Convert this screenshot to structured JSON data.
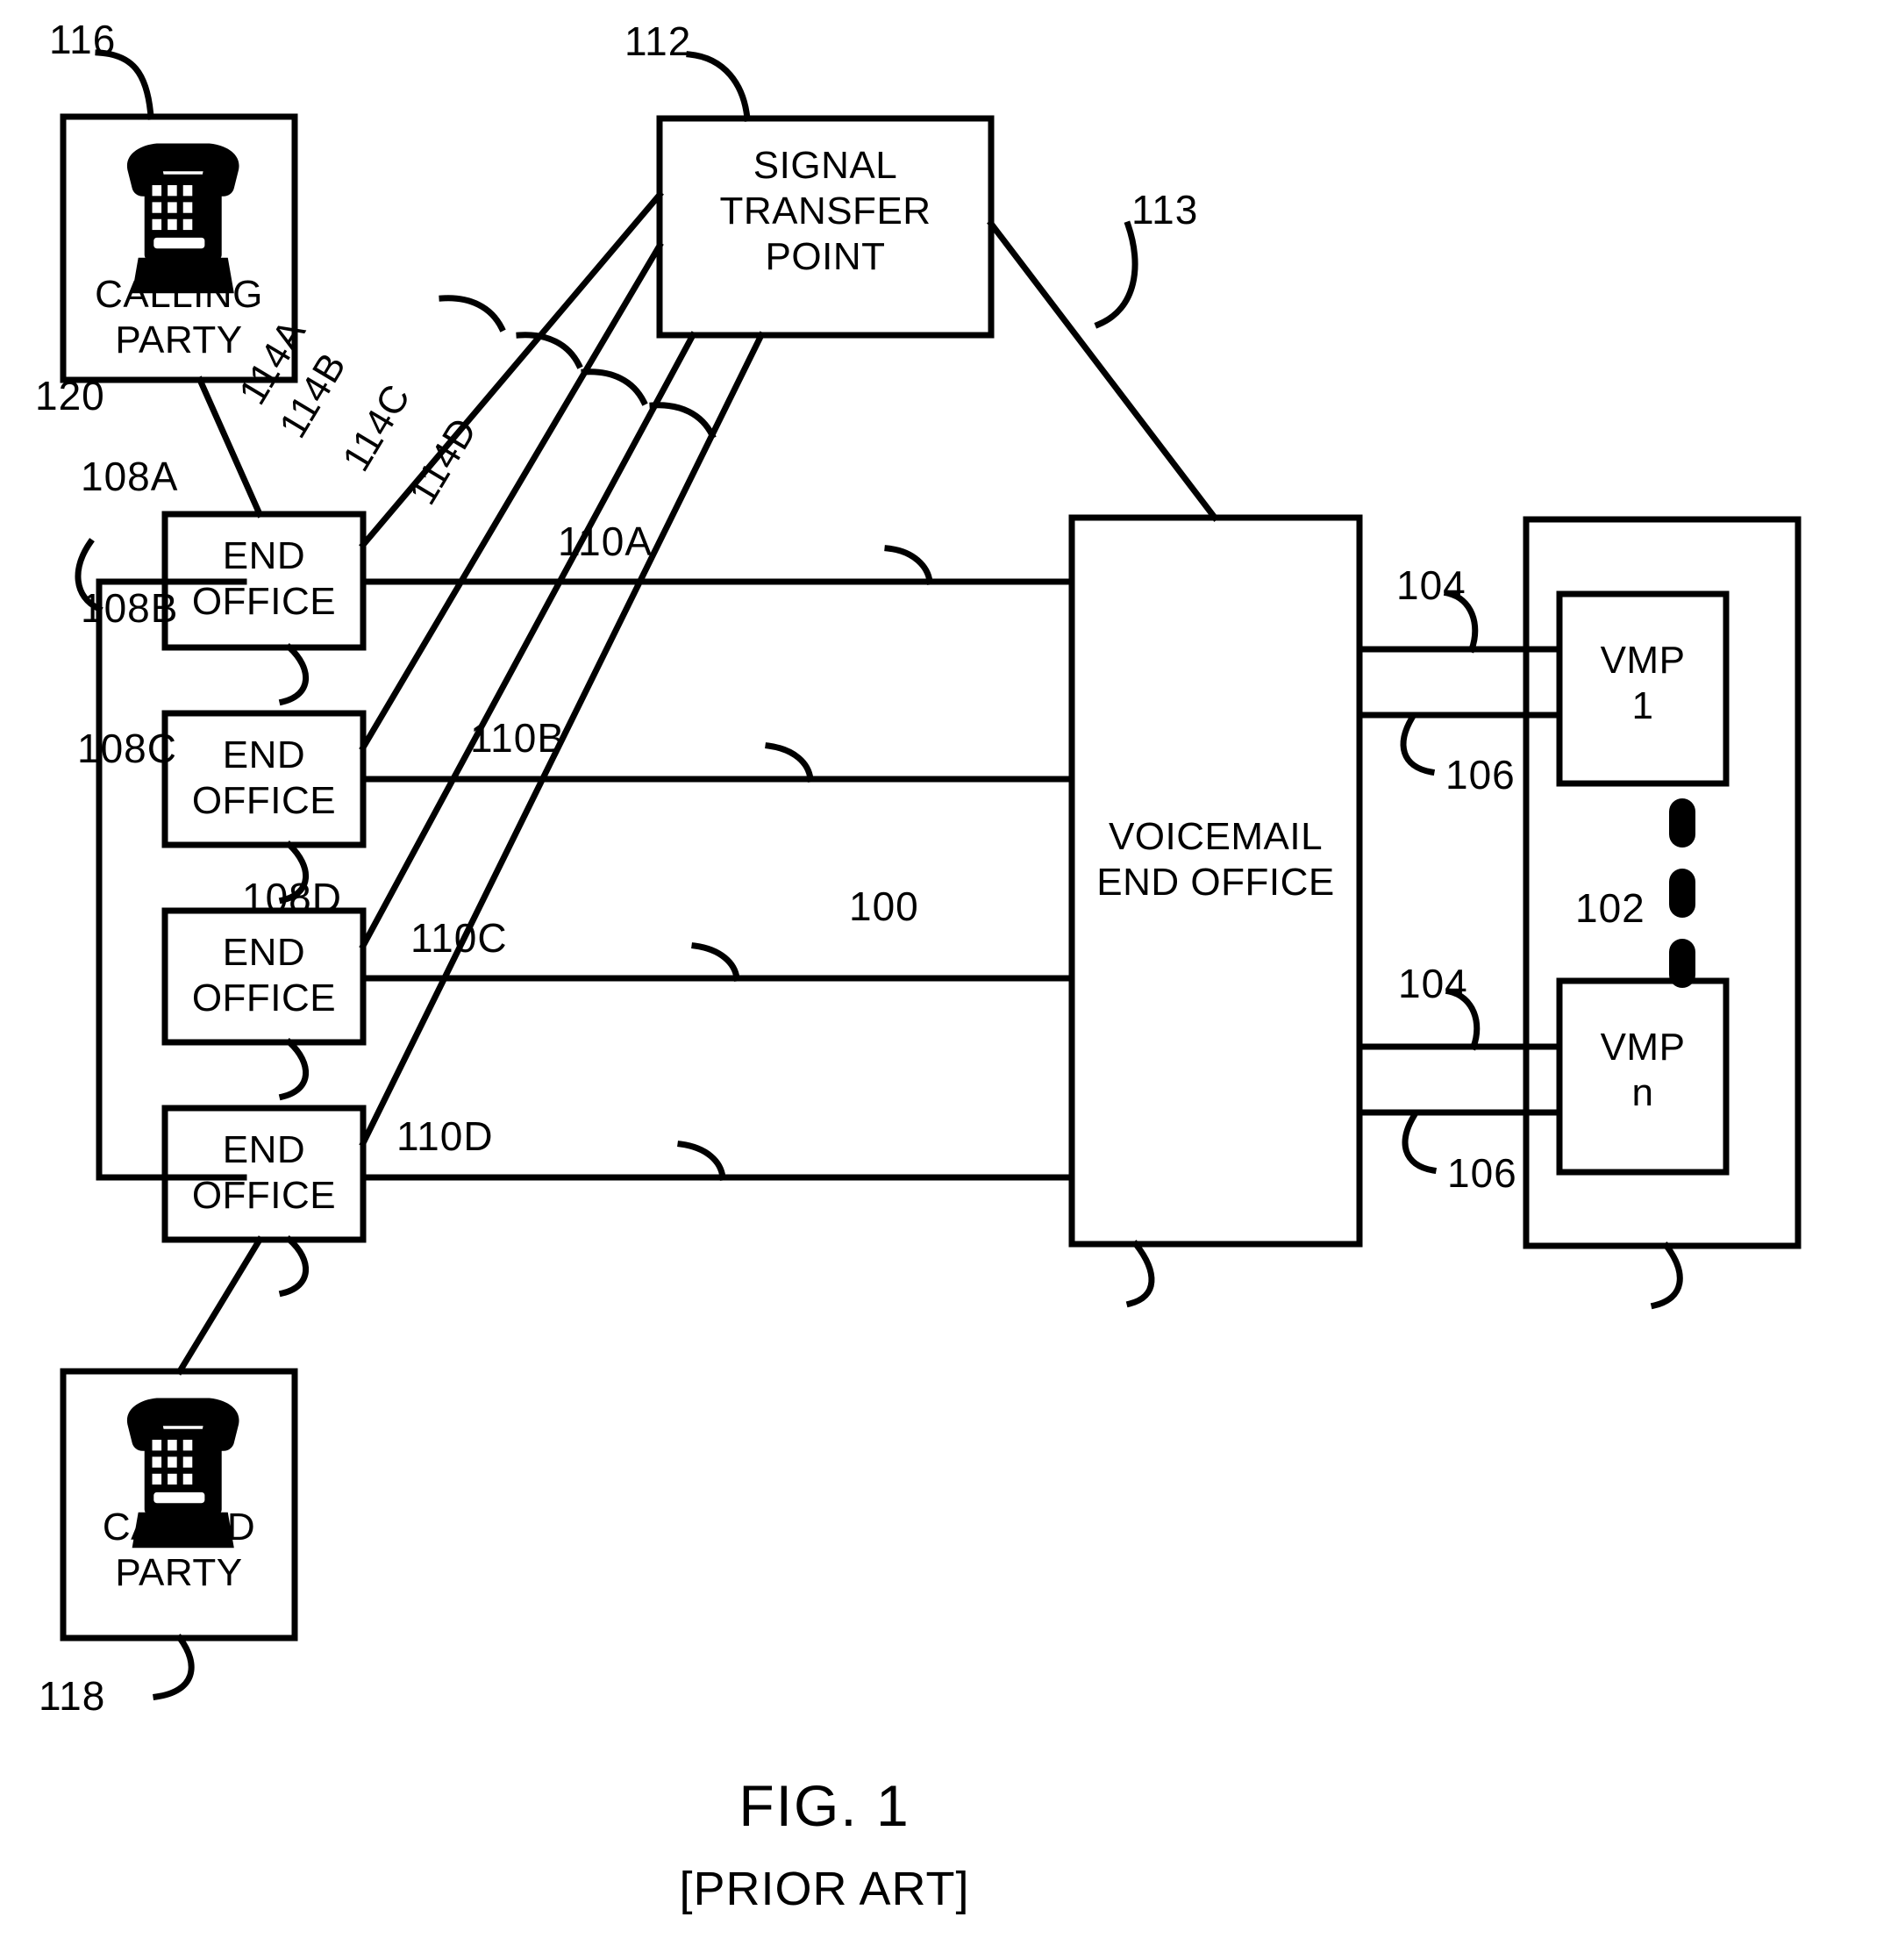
{
  "figure": {
    "caption": "FIG. 1",
    "subcaption": "[PRIOR ART]",
    "line_color": "#000000",
    "background_color": "#ffffff"
  },
  "nodes": {
    "calling_party": {
      "label": "CALLING\nPARTY",
      "ref": "116",
      "icon": "telephone-icon"
    },
    "called_party": {
      "label": "CALLED\nPARTY",
      "ref": "118",
      "icon": "telephone-icon"
    },
    "signal_transfer_point": {
      "label": "SIGNAL\nTRANSFER\nPOINT",
      "ref": "112"
    },
    "end_office_a": {
      "label": "END\nOFFICE",
      "ref": "108A"
    },
    "end_office_b": {
      "label": "END\nOFFICE",
      "ref": "108B"
    },
    "end_office_c": {
      "label": "END\nOFFICE",
      "ref": "108C"
    },
    "end_office_d": {
      "label": "END\nOFFICE",
      "ref": "108D"
    },
    "voicemail_end_office": {
      "label": "VOICEMAIL\nEND OFFICE",
      "ref": "100"
    },
    "vmp_group": {
      "ref": "102"
    },
    "vmp_1": {
      "label": "VMP\n1"
    },
    "vmp_n": {
      "label": "VMP\nn"
    }
  },
  "links": {
    "trunk_a": "110A",
    "trunk_b": "110B",
    "trunk_c": "110C",
    "trunk_d": "110D",
    "ss7_a": "114A",
    "ss7_b": "114B",
    "ss7_c": "114C",
    "ss7_d": "114D",
    "stp_to_vmeo": "113",
    "vmp_link_top": "104",
    "vmp_link_top2": "106",
    "vmp_link_bottom": "104",
    "vmp_link_bottom2": "106",
    "network_bracket": "120"
  }
}
